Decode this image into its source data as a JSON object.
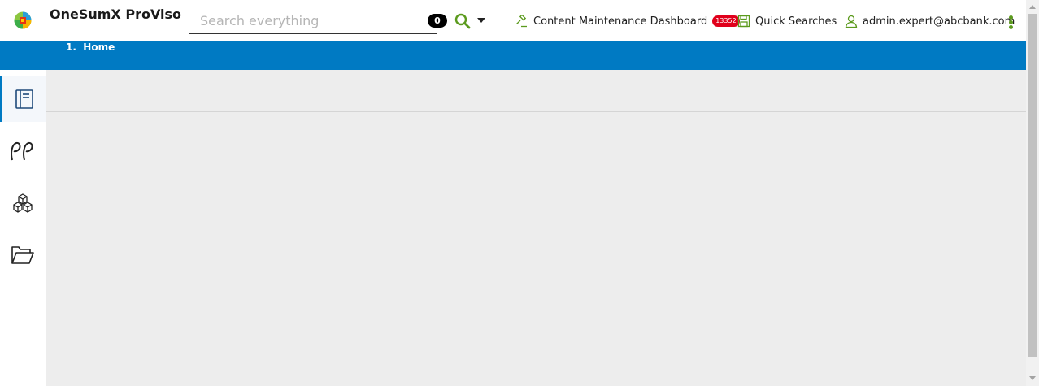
{
  "app": {
    "title": "OneSumX ProViso"
  },
  "search": {
    "placeholder": "Search everything",
    "value": "",
    "count": "0"
  },
  "header": {
    "dashboard_label": "Content Maintenance Dashboard",
    "dashboard_badge": "13352",
    "quick_searches_label": "Quick Searches",
    "user_label": "admin.expert@abcbank.com"
  },
  "breadcrumb": {
    "items": [
      {
        "number": "1.",
        "label": "Home"
      }
    ]
  },
  "sidebar": {
    "items": [
      {
        "icon": "notebook-icon",
        "active": true
      },
      {
        "icon": "quote-icon",
        "active": false
      },
      {
        "icon": "cubes-icon",
        "active": false
      },
      {
        "icon": "folder-open-icon",
        "active": false
      }
    ]
  },
  "colors": {
    "brand_blue": "#007ac3",
    "accent_green": "#5b9a1d",
    "badge_red": "#e0001b",
    "content_bg": "#ededed"
  }
}
